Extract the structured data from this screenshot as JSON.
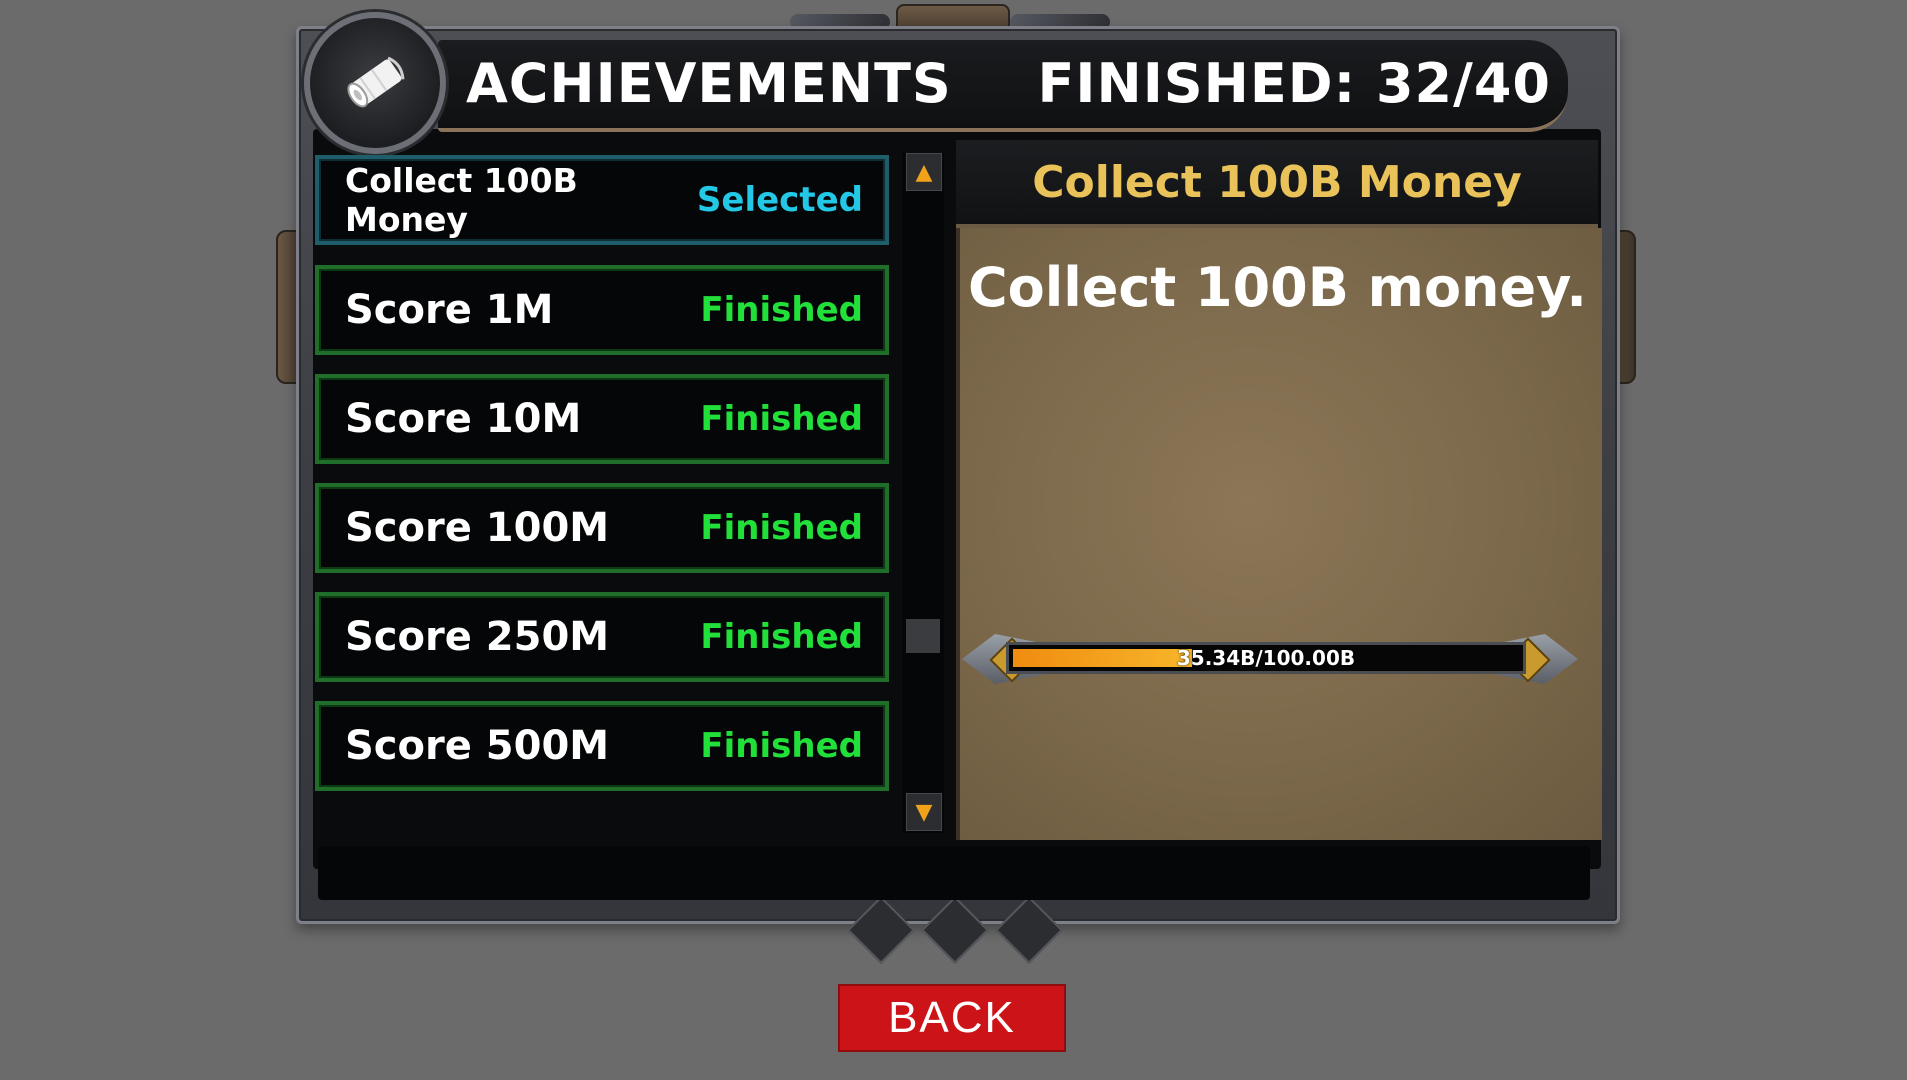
{
  "header": {
    "title": "ACHIEVEMENTS",
    "finished": "FINISHED: 32/40",
    "icon": "scroll-icon"
  },
  "achievements": [
    {
      "label": "Collect 100B Money",
      "status": "Selected",
      "selected": true
    },
    {
      "label": "Score 1M",
      "status": "Finished",
      "selected": false
    },
    {
      "label": "Score 10M",
      "status": "Finished",
      "selected": false
    },
    {
      "label": "Score 100M",
      "status": "Finished",
      "selected": false
    },
    {
      "label": "Score 250M",
      "status": "Finished",
      "selected": false
    },
    {
      "label": "Score 500M",
      "status": "Finished",
      "selected": false
    }
  ],
  "detail": {
    "title": "Collect 100B Money",
    "description": "Collect 100B money.",
    "progress_text": "35.34B/100.00B",
    "progress_fraction": 0.3534
  },
  "back_label": "BACK",
  "colors": {
    "finished": "#22e03a",
    "selected": "#22c8e6",
    "detail_title": "#e9c35a",
    "back_button": "#cc1418",
    "progress_fill": "#f29a16"
  }
}
